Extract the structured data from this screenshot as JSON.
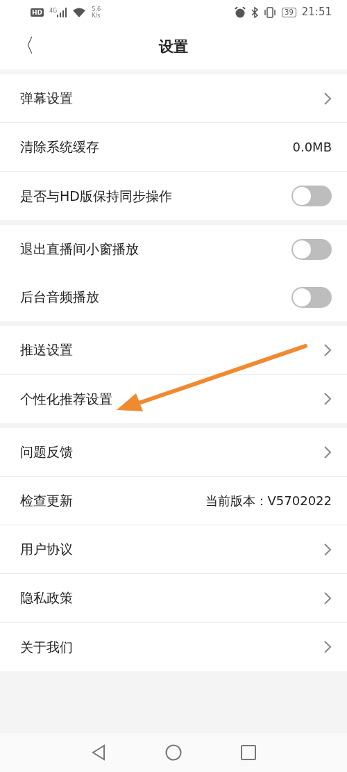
{
  "status_bar": {
    "hd_badge": "HD",
    "network": "4G",
    "speed_value": "5.6",
    "speed_unit": "K/s",
    "battery": "39",
    "time": "21:51"
  },
  "header": {
    "back": "〈",
    "title": "设置"
  },
  "groups": [
    {
      "rows": [
        {
          "kind": "link",
          "label": "弹幕设置"
        },
        {
          "kind": "value",
          "label": "清除系统缓存",
          "value": "0.0MB"
        },
        {
          "kind": "toggle",
          "label": "是否与HD版保持同步操作",
          "on": false
        }
      ]
    },
    {
      "rows": [
        {
          "kind": "toggle",
          "label": "退出直播间小窗播放",
          "on": false
        },
        {
          "kind": "toggle",
          "label": "后台音频播放",
          "on": false
        }
      ]
    },
    {
      "rows": [
        {
          "kind": "link",
          "label": "推送设置"
        },
        {
          "kind": "link",
          "label": "个性化推荐设置"
        }
      ]
    },
    {
      "rows": [
        {
          "kind": "link",
          "label": "问题反馈"
        },
        {
          "kind": "value",
          "label": "检查更新",
          "value": "当前版本：V5702022"
        },
        {
          "kind": "link",
          "label": "用户协议"
        },
        {
          "kind": "link",
          "label": "隐私政策"
        },
        {
          "kind": "link",
          "label": "关于我们"
        }
      ]
    }
  ]
}
